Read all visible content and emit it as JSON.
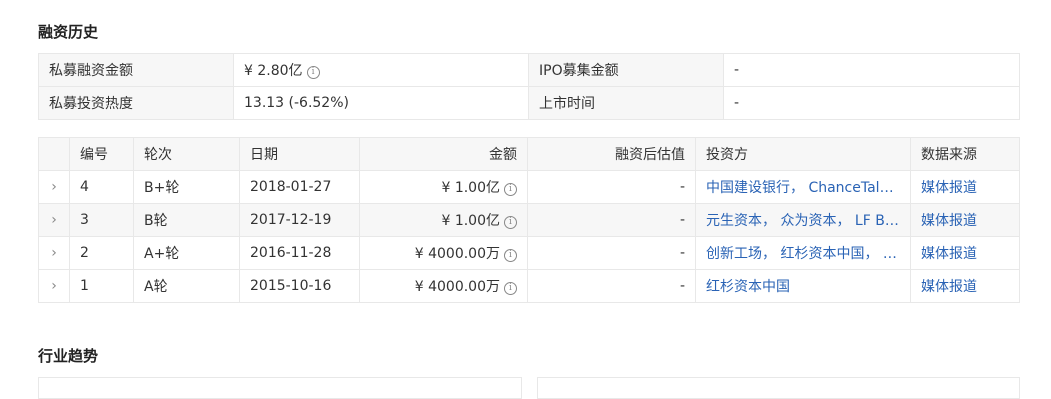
{
  "sections": {
    "financing_history": "融资历史",
    "industry_trend": "行业趋势"
  },
  "summary": {
    "private_amount_label": "私募融资金额",
    "private_amount_value": "¥ 2.80亿",
    "ipo_amount_label": "IPO募集金额",
    "ipo_amount_value": "-",
    "heat_label": "私募投资热度",
    "heat_value": "13.13 (-6.52%)",
    "listing_time_label": "上市时间",
    "listing_time_value": "-"
  },
  "rounds": {
    "headers": [
      "编号",
      "轮次",
      "日期",
      "金额",
      "融资后估值",
      "投资方",
      "数据来源"
    ],
    "rows": [
      {
        "no": "4",
        "round": "B+轮",
        "date": "2018-01-27",
        "amount": "¥ 1.00亿",
        "valuation": "-",
        "investors": "中国建设银行， ChanceTale…",
        "source": "媒体报道"
      },
      {
        "no": "3",
        "round": "B轮",
        "date": "2017-12-19",
        "amount": "¥ 1.00亿",
        "valuation": "-",
        "investors": "元生资本， 众为资本， LF Be…",
        "source": "媒体报道"
      },
      {
        "no": "2",
        "round": "A+轮",
        "date": "2016-11-28",
        "amount": "¥ 4000.00万",
        "valuation": "-",
        "investors": "创新工场， 红杉资本中国， …",
        "source": "媒体报道"
      },
      {
        "no": "1",
        "round": "A轮",
        "date": "2015-10-16",
        "amount": "¥ 4000.00万",
        "valuation": "-",
        "investors": "红杉资本中国",
        "source": "媒体报道"
      }
    ]
  },
  "icons": {
    "info": "i",
    "expand": "›"
  },
  "colors": {
    "positive_green": "#1a9a3a",
    "link_blue": "#2a63b5",
    "header_bg": "#f7f7f7",
    "border": "#e8e8e8"
  }
}
